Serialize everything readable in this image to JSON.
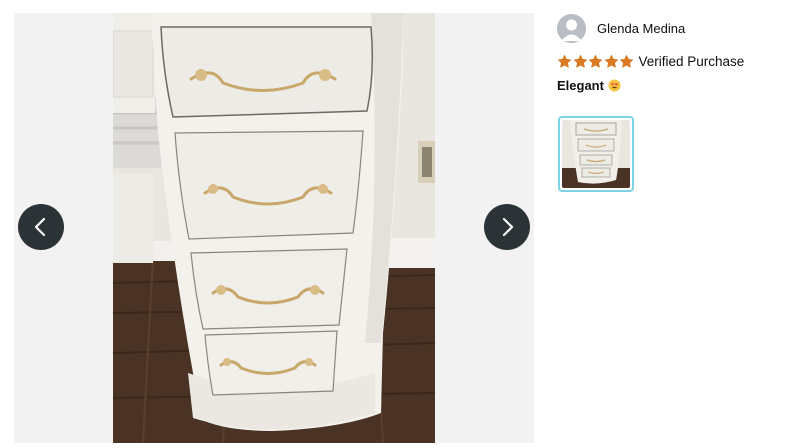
{
  "review": {
    "reviewer_name": "Glenda Medina",
    "rating": 5,
    "rating_max": 5,
    "verified_label": "Verified Purchase",
    "title": "Elegant",
    "title_emoji": "smiling-face-with-heart-eyes"
  },
  "viewer": {
    "prev_icon": "chevron-left-icon",
    "next_icon": "chevron-right-icon",
    "photo": "white-vanity-desk-drawers-with-gold-handles"
  },
  "thumbnails": [
    {
      "selected": true,
      "photo": "white-vanity-desk-drawers-with-gold-handles"
    }
  ],
  "colors": {
    "star": "#de7921",
    "nav_button": "#2c3337",
    "thumb_selected_border": "#7fd3e6",
    "viewer_background": "#f2f2f2"
  }
}
